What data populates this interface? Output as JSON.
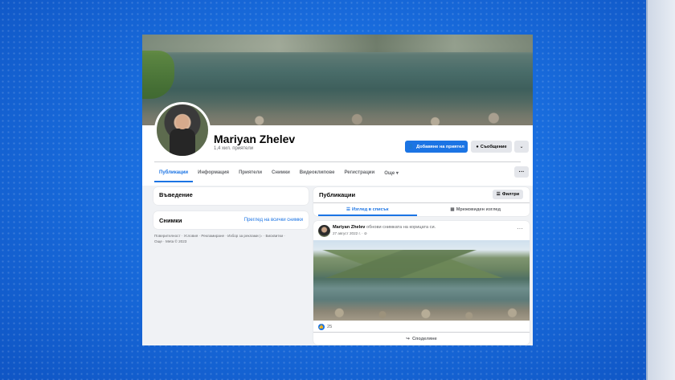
{
  "profile": {
    "name": "Mariyan Zhelev",
    "friends": "1,4 хил. приятели",
    "add_friend_label": "Добавяне на приятел",
    "message_label": "Съобщение",
    "more_icon": "chevron-down-icon"
  },
  "tabs": [
    {
      "label": "Публикации",
      "active": true
    },
    {
      "label": "Информация"
    },
    {
      "label": "Приятели"
    },
    {
      "label": "Снимки"
    },
    {
      "label": "Видеоклипове"
    },
    {
      "label": "Регистрации"
    },
    {
      "label": "Още ▾"
    }
  ],
  "tabs_more_label": "···",
  "intro": {
    "title": "Въведение"
  },
  "photos": {
    "title": "Снимки",
    "link": "Преглед на всички снимки"
  },
  "footer": {
    "line1": "Поверителност · Условия · Рекламиране · Избор за реклами ▷ · Бисквитки ·",
    "line2": "Още · Meta © 2023"
  },
  "publications": {
    "title": "Публикации",
    "filters_label": "Филтри",
    "list_view_label": "Изглед в списък",
    "grid_view_label": "Мрежовиден изглед"
  },
  "post": {
    "author": "Mariyan Zhelev",
    "action": " обнови снимката на корицата си.",
    "date": "27 август 2022 г. · ⊘",
    "menu_label": "···",
    "likes": "25",
    "share_label": "Споделяне"
  },
  "colors": {
    "accent": "#1b74e4",
    "page_bg": "#f0f2f5",
    "tv_bg": "#1565d8"
  }
}
